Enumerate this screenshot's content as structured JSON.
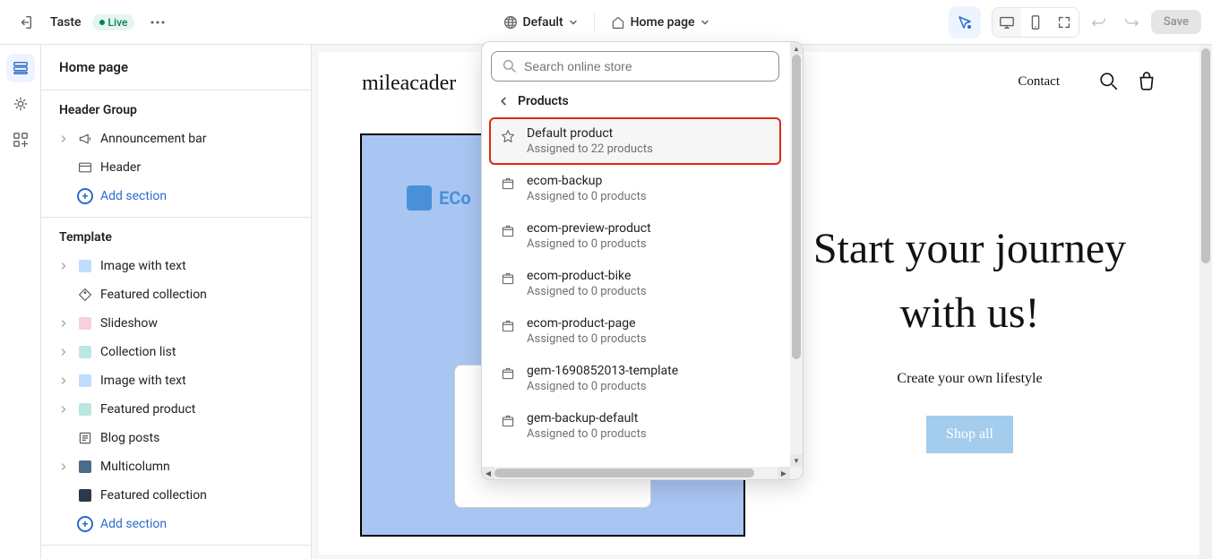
{
  "topbar": {
    "theme_name": "Taste",
    "status": "Live",
    "locale_label": "Default",
    "page_label": "Home page",
    "save_label": "Save"
  },
  "sidebar": {
    "title": "Home page",
    "groups": [
      {
        "title": "Header Group",
        "items": [
          {
            "label": "Announcement bar",
            "icon": "announcement",
            "expandable": true
          },
          {
            "label": "Header",
            "icon": "header",
            "expandable": false
          }
        ],
        "add_label": "Add section"
      },
      {
        "title": "Template",
        "items": [
          {
            "label": "Image with text",
            "icon": "sq-blue",
            "expandable": true
          },
          {
            "label": "Featured collection",
            "icon": "tag",
            "expandable": false
          },
          {
            "label": "Slideshow",
            "icon": "sq-pink",
            "expandable": true
          },
          {
            "label": "Collection list",
            "icon": "sq-teal",
            "expandable": true
          },
          {
            "label": "Image with text",
            "icon": "sq-blue",
            "expandable": true
          },
          {
            "label": "Featured product",
            "icon": "sq-teal",
            "expandable": true
          },
          {
            "label": "Blog posts",
            "icon": "blog",
            "expandable": false
          },
          {
            "label": "Multicolumn",
            "icon": "multi",
            "expandable": true
          },
          {
            "label": "Featured collection",
            "icon": "featured",
            "expandable": false
          }
        ],
        "add_label": "Add section"
      }
    ]
  },
  "preview": {
    "logo": "mileacader",
    "nav_contact": "Contact",
    "eco_text": "ECo",
    "hero_title": "Start your journey with us!",
    "hero_sub": "Create your own lifestyle",
    "hero_cta": "Shop all"
  },
  "dropdown": {
    "search_placeholder": "Search online store",
    "breadcrumb": "Products",
    "items": [
      {
        "name": "Default product",
        "sub": "Assigned to 22 products",
        "icon": "star",
        "highlight": true
      },
      {
        "name": "ecom-backup",
        "sub": "Assigned to 0 products",
        "icon": "package"
      },
      {
        "name": "ecom-preview-product",
        "sub": "Assigned to 0 products",
        "icon": "package"
      },
      {
        "name": "ecom-product-bike",
        "sub": "Assigned to 0 products",
        "icon": "package"
      },
      {
        "name": "ecom-product-page",
        "sub": "Assigned to 0 products",
        "icon": "package"
      },
      {
        "name": "gem-1690852013-template",
        "sub": "Assigned to 0 products",
        "icon": "package"
      },
      {
        "name": "gem-backup-default",
        "sub": "Assigned to 0 products",
        "icon": "package"
      }
    ]
  }
}
